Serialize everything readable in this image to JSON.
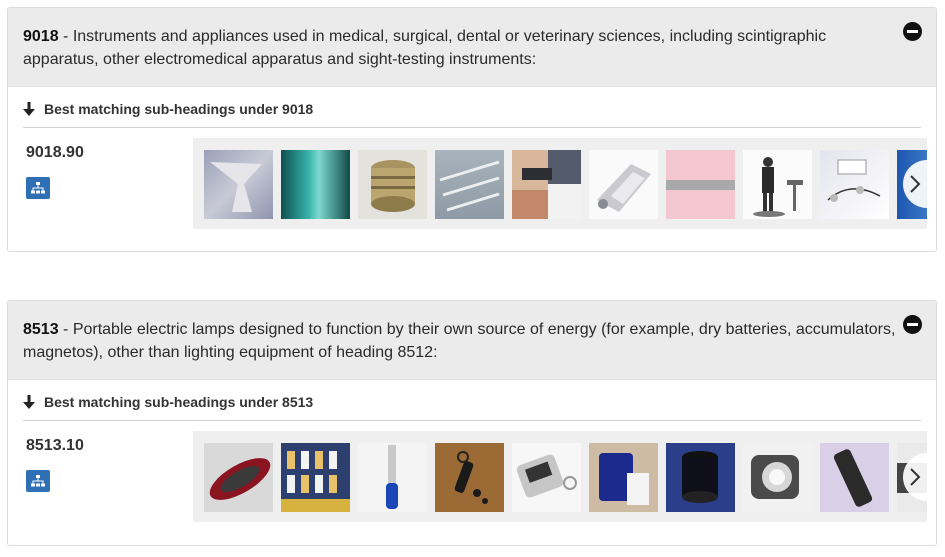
{
  "sections": [
    {
      "code": "9018",
      "description": " - Instruments and appliances used in medical, surgical, dental or veterinary sciences, including scintigraphic apparatus, other electromedical apparatus and sight-testing instruments:",
      "subheadings_title": "Best matching sub-headings under 9018",
      "subheading_code": "9018.90",
      "images": [
        "funnel-image",
        "green-tube-image",
        "brass-fitting-image",
        "syringes-image",
        "hands-procedure-image",
        "dental-device-image",
        "pink-strip-image",
        "treadmill-station-image",
        "electrodes-image",
        "blue-device-image"
      ]
    },
    {
      "code": "8513",
      "description": " - Portable electric lamps designed to function by their own source of energy (for example, dry batteries, accumulators, magnetos), other than lighting equipment of heading 8512:",
      "subheadings_title": "Best matching sub-headings under 8513",
      "subheading_code": "8513.10",
      "images": [
        "red-torch-image",
        "lamp-display-box-image",
        "blue-penlight-image",
        "keychain-light-image",
        "solar-keychain-image",
        "blue-lantern-image",
        "blue-cylinder-lamp-image",
        "work-spotlight-image",
        "black-flashlight-image",
        "partial-lamp-image"
      ]
    }
  ],
  "colors": {
    "header_bg": "#ebebeb",
    "tree_button": "#2f6fb4",
    "gallery_bg": "#efefef"
  },
  "icons": {
    "collapse": "minus-circle-icon",
    "arrow": "arrow-down-icon",
    "tree": "sitemap-icon",
    "next": "chevron-right-icon"
  }
}
